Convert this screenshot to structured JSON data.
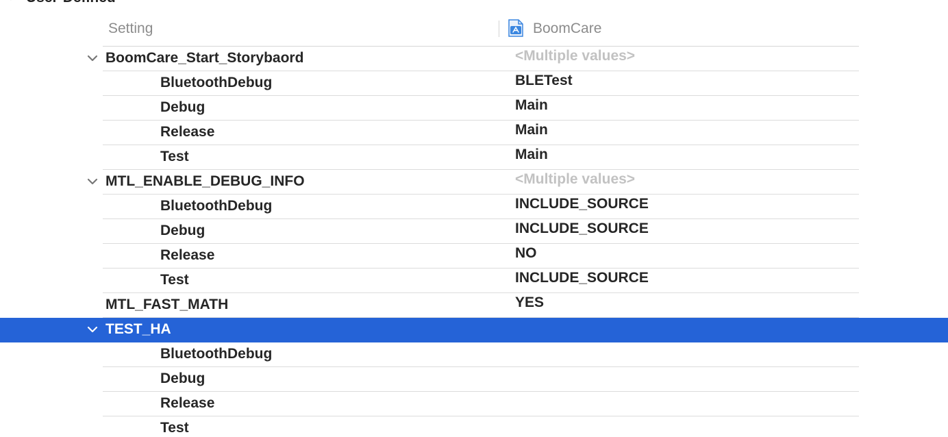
{
  "section": {
    "title": "User-Defined"
  },
  "columns": {
    "setting": "Setting",
    "target": "BoomCare",
    "target_icon": "app-target-icon"
  },
  "colors": {
    "selection": "#2563d7",
    "multiple_values": "#c2c2c2"
  },
  "rows": [
    {
      "name": "BoomCare_Start_Storybaord",
      "value": "<Multiple values>",
      "level": 0,
      "expandable": true,
      "multiple": true,
      "selected": false
    },
    {
      "name": "BluetoothDebug",
      "value": "BLETest",
      "level": 1
    },
    {
      "name": "Debug",
      "value": "Main",
      "level": 1
    },
    {
      "name": "Release",
      "value": "Main",
      "level": 1
    },
    {
      "name": "Test",
      "value": "Main",
      "level": 1
    },
    {
      "name": "MTL_ENABLE_DEBUG_INFO",
      "value": "<Multiple values>",
      "level": 0,
      "expandable": true,
      "multiple": true,
      "selected": false
    },
    {
      "name": "BluetoothDebug",
      "value": "INCLUDE_SOURCE",
      "level": 1
    },
    {
      "name": "Debug",
      "value": "INCLUDE_SOURCE",
      "level": 1
    },
    {
      "name": "Release",
      "value": "NO",
      "level": 1
    },
    {
      "name": "Test",
      "value": "INCLUDE_SOURCE",
      "level": 1
    },
    {
      "name": "MTL_FAST_MATH",
      "value": "YES",
      "level": 0,
      "expandable": false,
      "selected": false
    },
    {
      "name": "TEST_HA",
      "value": "",
      "level": 0,
      "expandable": true,
      "selected": true
    },
    {
      "name": "BluetoothDebug",
      "value": "",
      "level": 1
    },
    {
      "name": "Debug",
      "value": "",
      "level": 1
    },
    {
      "name": "Release",
      "value": "",
      "level": 1
    },
    {
      "name": "Test",
      "value": "",
      "level": 1
    }
  ]
}
